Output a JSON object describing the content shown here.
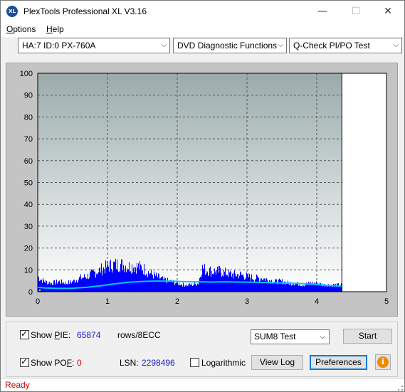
{
  "window": {
    "title": "PlexTools Professional XL V3.16",
    "app_icon": "XL",
    "minimize_glyph": "—",
    "maximize_glyph": "☐",
    "close_glyph": "✕"
  },
  "menu": {
    "items": [
      {
        "label": "Options",
        "accel": "O"
      },
      {
        "label": "Help",
        "accel": "H"
      }
    ]
  },
  "toolbar": {
    "drive": "HA:7 ID:0  PX-760A",
    "function": "DVD Diagnostic Functions",
    "test": "Q-Check PI/PO Test"
  },
  "chart_data": {
    "type": "area",
    "x_ticks": [
      "0",
      "1",
      "2",
      "3",
      "4",
      "5"
    ],
    "y_ticks": [
      "0",
      "10",
      "20",
      "30",
      "40",
      "50",
      "60",
      "70",
      "80",
      "90",
      "100"
    ],
    "xlim": [
      0,
      5
    ],
    "ylim": [
      0,
      100
    ],
    "grid": true,
    "end_marker_x": 4.36,
    "colors": {
      "pie_bars": "#0000ff",
      "average_line": "#00c8ff",
      "plot_bg_top": "#9aabab",
      "plot_bg_bottom": "#ffffff",
      "po_marker": "#ffff00"
    },
    "series": [
      {
        "values_type": "pie_max_envelope",
        "x": [
          0.0,
          0.05,
          0.1,
          0.2,
          0.3,
          0.4,
          0.5,
          0.6,
          0.7,
          0.8,
          0.9,
          1.0,
          1.1,
          1.2,
          1.3,
          1.4,
          1.5,
          1.6,
          1.7,
          1.8,
          1.9,
          2.0,
          2.1,
          2.2,
          2.3,
          2.35,
          2.4,
          2.5,
          2.6,
          2.7,
          2.8,
          2.9,
          3.0,
          3.1,
          3.2,
          3.3,
          3.4,
          3.5,
          3.6,
          3.7,
          3.8,
          3.9,
          4.0,
          4.1,
          4.2,
          4.3,
          4.36
        ],
        "y": [
          9,
          7,
          6,
          5,
          6,
          5,
          6,
          8,
          9,
          11,
          13,
          15,
          16,
          16,
          15,
          15,
          14,
          11,
          9,
          7,
          6,
          5,
          4,
          4,
          5,
          14,
          13,
          12,
          12,
          11,
          10,
          10,
          9,
          8,
          8,
          7,
          6,
          6,
          5,
          5,
          4,
          5,
          5,
          4,
          4,
          4,
          4
        ]
      },
      {
        "values_type": "average",
        "x": [
          0.0,
          0.1,
          0.3,
          0.5,
          0.7,
          0.9,
          1.1,
          1.3,
          1.5,
          1.7,
          1.9,
          2.1,
          2.3,
          2.5,
          2.7,
          2.9,
          3.1,
          3.3,
          3.5,
          3.7,
          3.9,
          4.1,
          4.3,
          4.36
        ],
        "y": [
          2.0,
          1.7,
          1.5,
          1.6,
          2.0,
          2.7,
          3.6,
          4.3,
          4.7,
          4.9,
          4.8,
          4.6,
          4.5,
          4.4,
          4.5,
          4.4,
          4.3,
          4.2,
          4.0,
          3.8,
          3.5,
          3.0,
          2.6,
          2.4
        ]
      }
    ]
  },
  "controls": {
    "show_pie_label": "Show PIE:",
    "show_pie_accel": "P",
    "show_pie_checked": true,
    "pie_value": "65874",
    "rows_unit": "rows/8ECC",
    "show_pof_label": "Show POF:",
    "show_pof_accel": "F",
    "show_pof_checked": true,
    "pof_value": "0",
    "lsn_label": "LSN:",
    "lsn_value": "2298496",
    "logarithmic_label": "Logarithmic",
    "logarithmic_checked": false,
    "test_mode": "SUM8 Test",
    "start_label": "Start",
    "view_log_label": "View Log",
    "preferences_label": "Preferences",
    "info_glyph": "i",
    "check_glyph": "✓"
  },
  "status": {
    "text": "Ready"
  }
}
